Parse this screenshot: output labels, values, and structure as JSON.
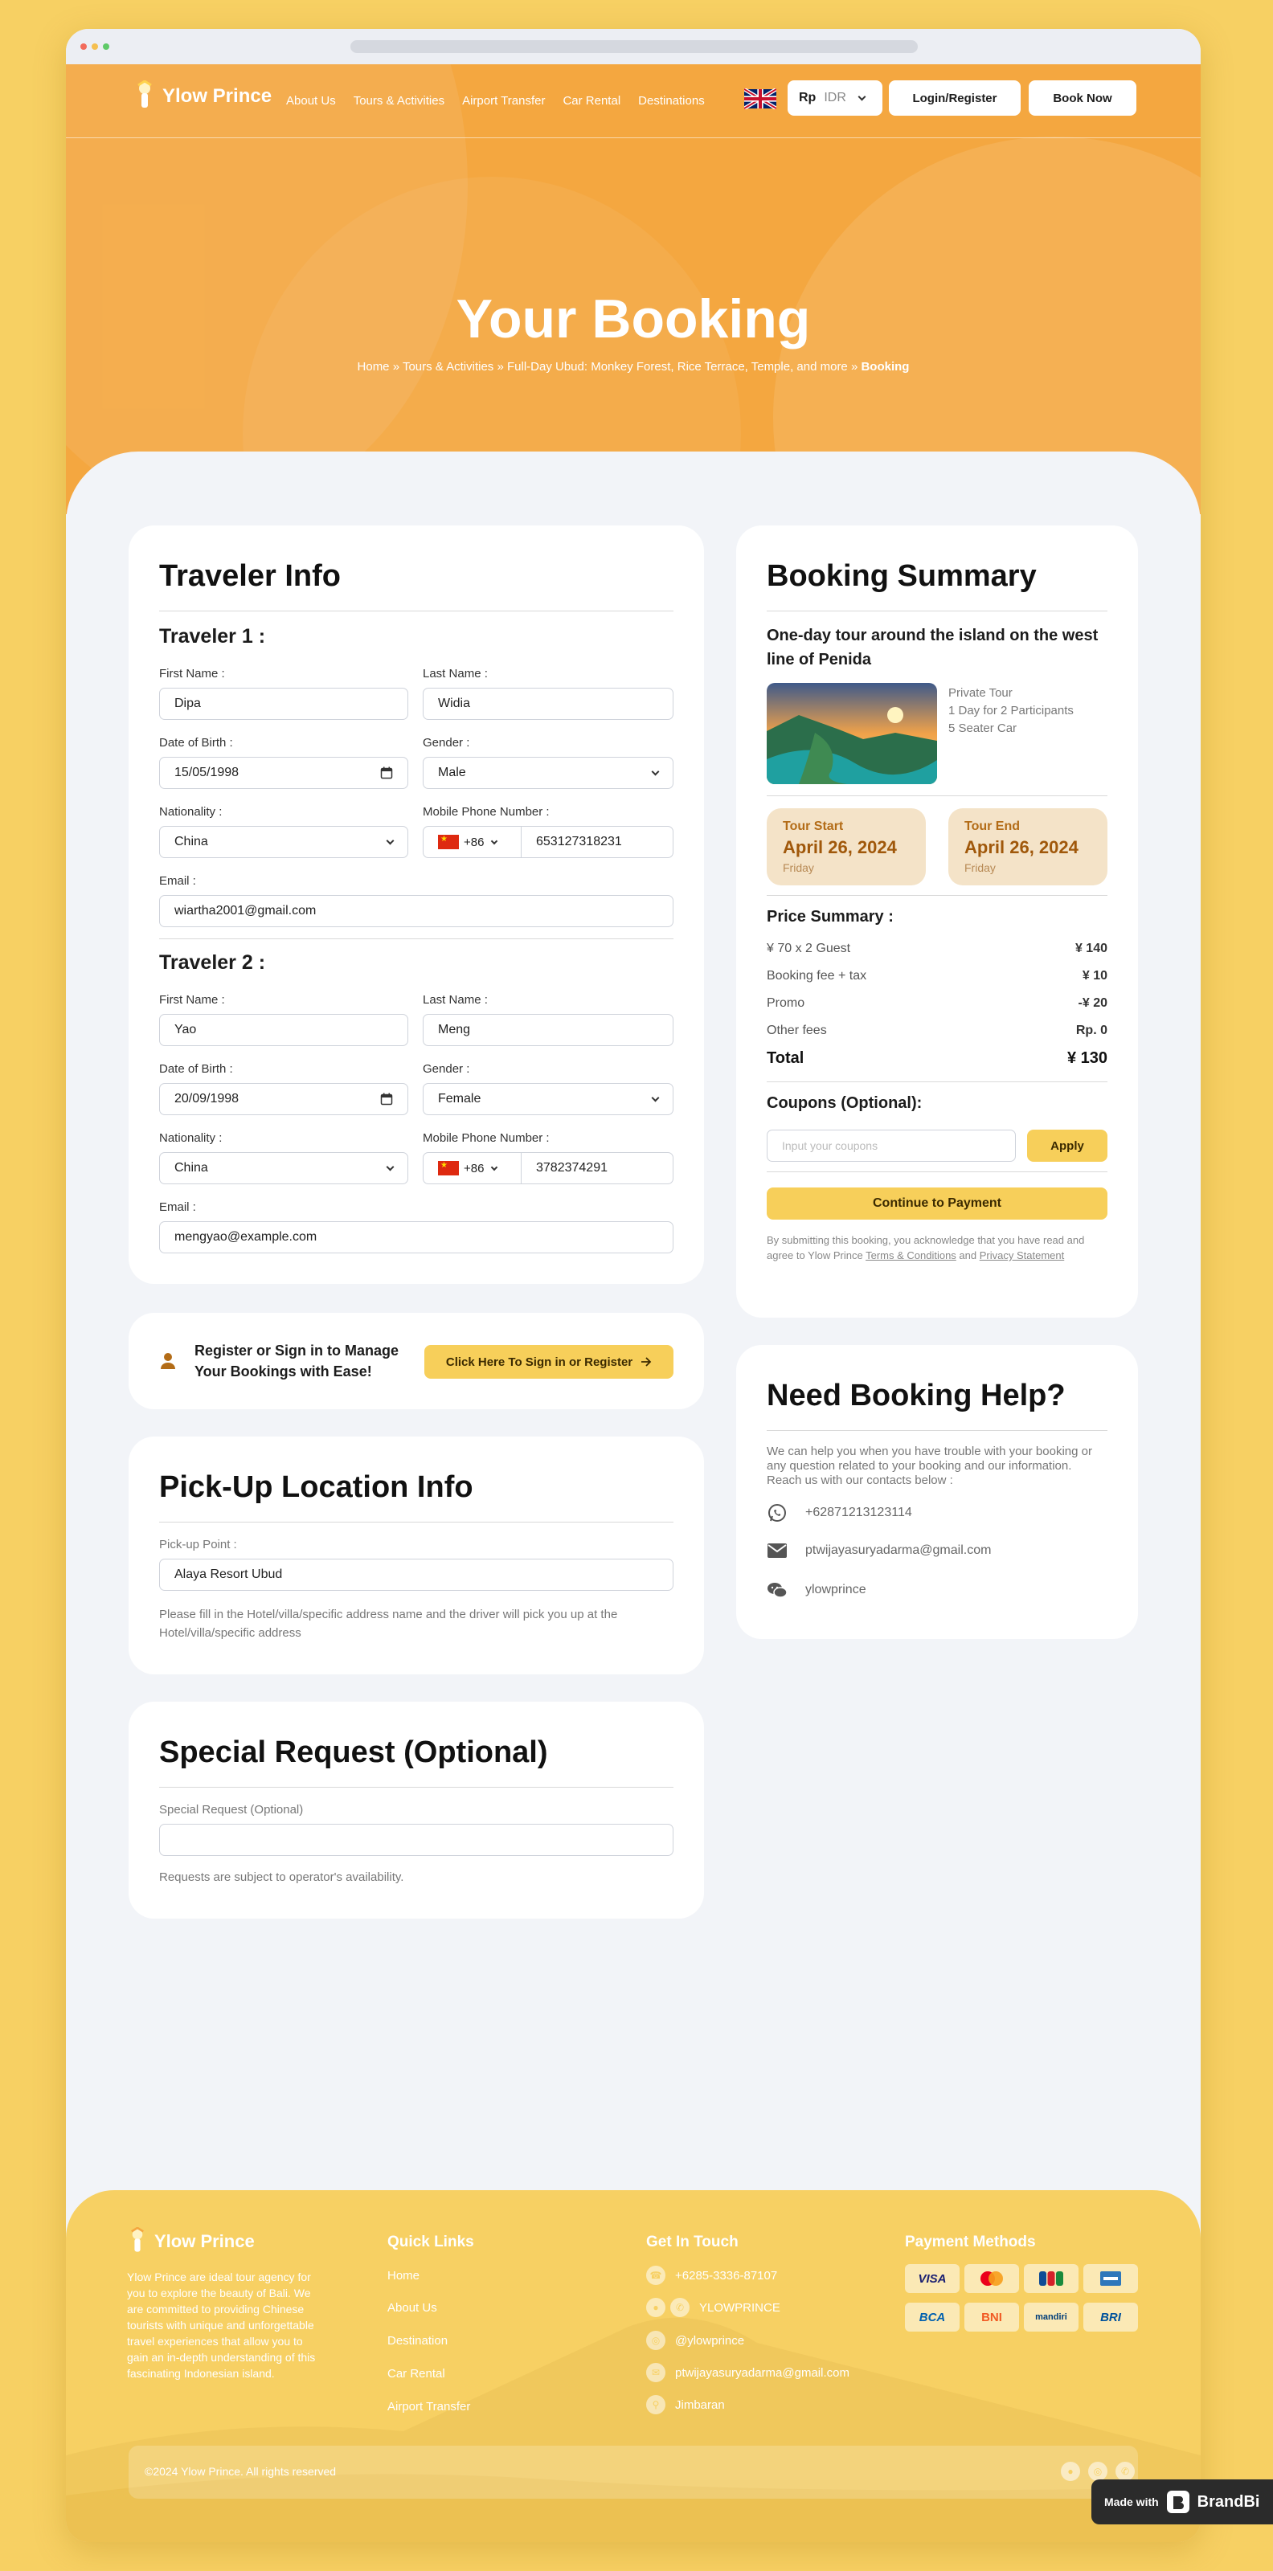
{
  "nav": {
    "brand": "Ylow Prince",
    "links": [
      "About Us",
      "Tours & Activities",
      "Airport Transfer",
      "Car Rental",
      "Destinations"
    ],
    "currency_symbol": "Rp",
    "currency_code": "IDR",
    "login": "Login/Register",
    "book": "Book Now"
  },
  "hero": {
    "title": "Your Booking",
    "crumb_home": "Home",
    "crumb_tours": "Tours & Activities",
    "crumb_tour": "Full-Day Ubud: Monkey Forest, Rice Terrace, Temple, and more",
    "crumb_current": "Booking",
    "sep": " » "
  },
  "traveler": {
    "title": "Traveler Info",
    "labels": {
      "first": "First Name :",
      "last": "Last Name :",
      "dob": "Date of Birth :",
      "gender": "Gender :",
      "nationality": "Nationality :",
      "phone": "Mobile Phone Number :",
      "email": "Email :"
    },
    "t1": {
      "heading": "Traveler 1 :",
      "first": "Dipa",
      "last": "Widia",
      "dob": "15/05/1998",
      "gender": "Male",
      "nationality": "China",
      "code": "+86",
      "phone": "653127318231",
      "email": "wiartha2001@gmail.com"
    },
    "t2": {
      "heading": "Traveler 2 :",
      "first": "Yao",
      "last": "Meng",
      "dob": "20/09/1998",
      "gender": "Female",
      "nationality": "China",
      "code": "+86",
      "phone": "3782374291",
      "email": "mengyao@example.com"
    }
  },
  "signin": {
    "text": "Register or Sign in to Manage Your Bookings with Ease!",
    "button": "Click Here To Sign in or Register"
  },
  "pickup": {
    "title": "Pick-Up Location Info",
    "label": "Pick-up Point :",
    "value": "Alaya Resort Ubud",
    "hint": "Please fill in the Hotel/villa/specific address name and the driver will pick you up at the Hotel/villa/specific address"
  },
  "special": {
    "title": "Special Request (Optional)",
    "label": "Special Request (Optional)",
    "hint": "Requests are subject to operator's availability."
  },
  "summary": {
    "title": "Booking Summary",
    "tour_name": "One-day tour around the island on the west line of Penida",
    "details": [
      "Private Tour",
      "1 Day for 2 Participants",
      "5 Seater Car"
    ],
    "start_label": "Tour Start",
    "start_date": "April 26, 2024",
    "start_day": "Friday",
    "end_label": "Tour End",
    "end_date": "April 26, 2024",
    "end_day": "Friday",
    "price_title": "Price Summary :",
    "rows": [
      {
        "label": "¥ 70 x 2 Guest",
        "value": "¥ 140"
      },
      {
        "label": "Booking fee + tax",
        "value": "¥ 10"
      },
      {
        "label": "Promo",
        "value": "-¥ 20"
      },
      {
        "label": "Other fees",
        "value": "Rp. 0"
      }
    ],
    "total_label": "Total",
    "total_value": "¥ 130",
    "coupon_title": "Coupons (Optional):",
    "coupon_placeholder": "Input your coupons",
    "apply": "Apply",
    "continue": "Continue to Payment",
    "terms_pre": "By submitting this booking, you acknowledge that you have read and agree to Ylow Prince ",
    "terms_link": "Terms & Conditions",
    "terms_and": " and ",
    "privacy_link": "Privacy Statement"
  },
  "help": {
    "title": "Need Booking Help?",
    "text": "We can help you when you have trouble with your booking or any question related to your booking and our information. Reach us with our contacts below :",
    "whatsapp": "+6287121312311​4",
    "email": "ptwijayasuryadarma@gmail.com",
    "wechat": "ylowprince"
  },
  "footer": {
    "brand": "Ylow Prince",
    "about": "Ylow Prince are ideal tour agency for you to explore the beauty of Bali. We are committed to providing Chinese tourists with unique and unforgettable travel experiences that allow you to gain an in-depth understanding of this fascinating Indonesian island.",
    "quick_title": "Quick Links",
    "quick": [
      "Home",
      "About Us",
      "Destination",
      "Car Rental",
      "Airport Transfer"
    ],
    "touch_title": "Get In Touch",
    "phone": "+6285-3336-87107",
    "wechat": "YLOWPRINCE",
    "instagram": "@ylowprince",
    "email": "ptwijayasuryadarma@gmail.com",
    "location": "Jimbaran",
    "pay_title": "Payment Methods",
    "pay": [
      "VISA",
      "MC",
      "JCB",
      "AMEX",
      "BCA",
      "BNI",
      "mandiri",
      "BRI"
    ],
    "copyright": "©2024 Ylow Prince. All rights reserved"
  },
  "made": {
    "label": "Made with",
    "brand": "BrandBi"
  }
}
